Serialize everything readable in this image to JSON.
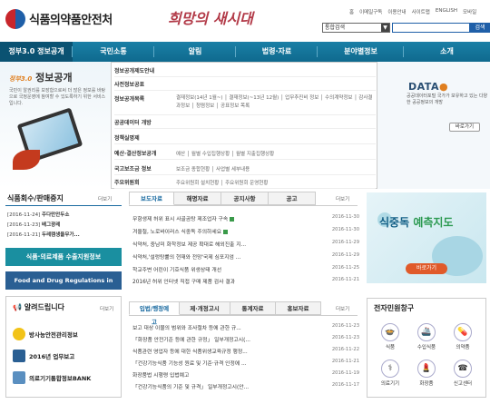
{
  "header": {
    "logo_text": "식품의약품안전처",
    "slogan": "희망의 새시대",
    "top_links": [
      "홈",
      "이메일구독",
      "이용안내",
      "사이트맵",
      "ENGLISH",
      "모바일"
    ],
    "search": {
      "scope": "통합검색",
      "placeholder": "",
      "button": "검색"
    }
  },
  "nav": {
    "items": [
      "정부3.0 정보공개",
      "국민소통",
      "알림",
      "법령·자료",
      "분야별정보",
      "소개"
    ]
  },
  "promo_left": {
    "badge": "정부3.0",
    "title": "정보공개",
    "desc": "국민이 알권리를 보장함으로써 더 많은 정보를 바탕으로 국정운영에 참여할 수 있도록하기 위한 서비스입니다."
  },
  "mega_menu": [
    {
      "head": "정보공개제도안내",
      "sub": ""
    },
    {
      "head": "사전정보공표",
      "sub": ""
    },
    {
      "head": "정보공개목록",
      "sub": "결재정보(14년 1월~) │ 결재정보(~13년 12월) │ 업무추진비 정보 │ 수의계약정보 │ 감사결과정보 │ 청렴정보 │ 공표정보 목록"
    },
    {
      "head": "공공데이터 개방",
      "sub": ""
    },
    {
      "head": "정책실명제",
      "sub": ""
    },
    {
      "head": "예산·결산정보공개",
      "sub": "예산 │ 월별 수입집행상황 │ 월별 지출집행상황"
    },
    {
      "head": "국고보조금 정보",
      "sub": "보조금 종합현황 │ 사업별 세부내용"
    },
    {
      "head": "주요위원회",
      "sub": "주요위원회 설치현황 │ 주요위원회 운영현황"
    }
  ],
  "promo_right": {
    "logo": "DATA",
    "desc": "공공데이터포털 국가가 보유하고 있는 다양한 공공정보의 개방",
    "more": "바로가기"
  },
  "recall": {
    "title": "식품회수/판매중지",
    "more": "더보기",
    "items": [
      {
        "date": "[2016-11-24]",
        "text": "주다만안두소"
      },
      {
        "date": "[2016-11-23]",
        "text": "배그광레"
      },
      {
        "date": "[2016-11-21]",
        "text": "두레캠생율무가..."
      }
    ]
  },
  "export_banner": "식품·의료제품 수출지원정보",
  "food_banner": "Food and Drug Regulations in Korea",
  "notice": {
    "title": "알려드립니다",
    "more": "더보기",
    "items": [
      "방사능안전관리정보",
      "2016년 업무보고",
      "의료기기통합정보BANK"
    ]
  },
  "board1": {
    "tabs": [
      "보도자료",
      "해명자료",
      "공지사항",
      "공고"
    ],
    "more": "더보기",
    "posts": [
      {
        "title": "무항생제 허위 표시 사골곰탕 제조업자 구속",
        "date": "2016-11-30",
        "new": true
      },
      {
        "title": "겨울철, 노로바이러스 식중독 주의하세요",
        "date": "2016-11-30",
        "new": true
      },
      {
        "title": "식약처, 중남미 화학정보 제공 확대로 해외진출 지...",
        "date": "2016-11-29",
        "new": false
      },
      {
        "title": "식약처,'설렁탕률의 현재와 전망'국제 심포지엄 ...",
        "date": "2016-11-29",
        "new": false
      },
      {
        "title": "학교주변 어린이 기호식품 위생상태 개선",
        "date": "2016-11-25",
        "new": false
      },
      {
        "title": "2016년 허위 인터넷 직접 구매 제품 검사 결과",
        "date": "2016-11-21",
        "new": false
      }
    ]
  },
  "board2": {
    "tabs": [
      "입법/행정예고",
      "제·개정고시",
      "통계자료",
      "홍보자료"
    ],
    "more": "더보기",
    "posts": [
      {
        "title": "보고 대상 이물의 범위와 조사절차 등에 관한 규...",
        "date": "2016-11-23"
      },
      {
        "title": "「화장품 안전기준 등에 관한 규정」 일부개정고시(...",
        "date": "2016-11-23"
      },
      {
        "title": "식품관련 영업자 등에 대한 식품위생교육규정 행정...",
        "date": "2016-11-22"
      },
      {
        "title": "「건강기능식품 기능성 원료 및 기준·규격 인정에 ...",
        "date": "2016-11-21"
      },
      {
        "title": "화장품법 시행령 입법예고",
        "date": "2016-11-19"
      },
      {
        "title": "「건강기능식품의 기준 및 규격」 일부개정고시(안...",
        "date": "2016-11-17"
      }
    ]
  },
  "dash_banner": {
    "title_a": "식중독",
    "title_b": "예측지도",
    "button": "바로가기"
  },
  "petition": {
    "title": "전자민원창구",
    "items": [
      "식품",
      "수입식품",
      "의약품",
      "의료기기",
      "화장품",
      "신고센터"
    ]
  },
  "colors": {
    "nav": "#137496",
    "brand_blue": "#1f5fa8",
    "brand_red": "#c8262b",
    "accent_orange": "#e07f1f"
  }
}
